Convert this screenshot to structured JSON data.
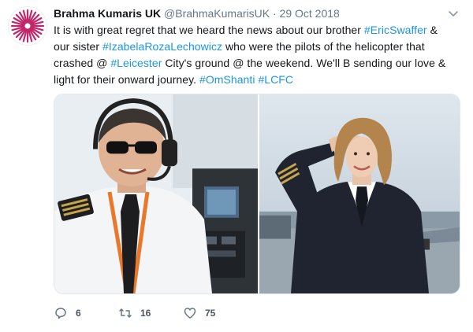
{
  "tweet": {
    "author_name": "Brahma Kumaris UK",
    "handle": "@BrahmaKumarisUK",
    "separator": "·",
    "date": "29 Oct 2018",
    "line1_a": "It is with great regret that we heard the news about our brother ",
    "line1_tag": "#EricSwaffer",
    "line1_b": " &",
    "line2_a": "our sister ",
    "line2_tag": "#IzabelaRozaLechowicz",
    "line2_b": " who were the pilots of the helicopter that",
    "line3_a": "crashed @ ",
    "line3_tag": "#Leicester",
    "line3_b": " City's ground @ the weekend. We'll B sending our love &",
    "line4_a": "light for their onward journey. ",
    "line4_tag1": "#OmShanti",
    "line4_space": " ",
    "line4_tag2": "#LCFC"
  },
  "actions": {
    "reply_count": "6",
    "retweet_count": "16",
    "like_count": "75"
  },
  "icons": {
    "avatar": "brahma-kumaris-logo",
    "menu": "chevron-down-icon",
    "reply": "reply-icon",
    "retweet": "retweet-icon",
    "like": "heart-icon"
  },
  "colors": {
    "link": "#1b95e0",
    "logo": "#c4266a",
    "muted": "#657786"
  }
}
